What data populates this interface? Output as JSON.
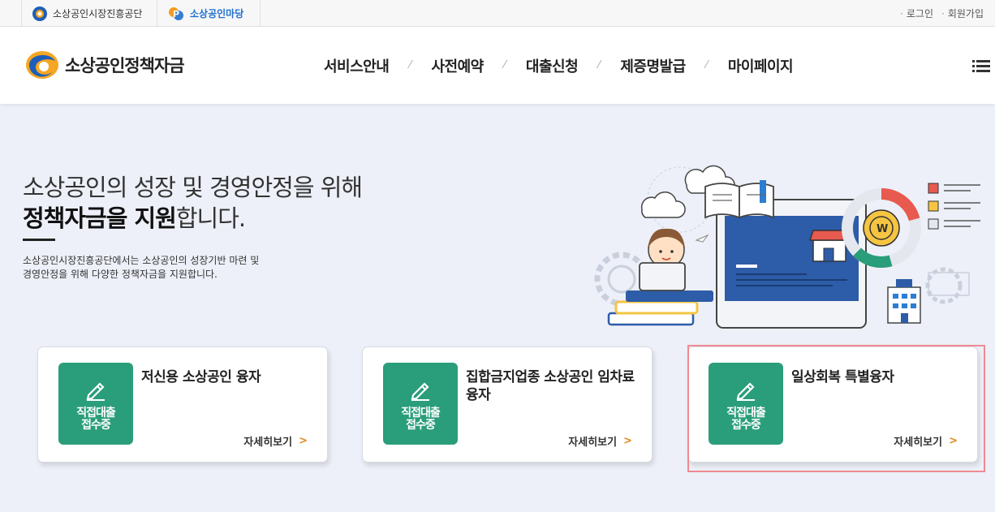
{
  "topbar": {
    "site1": "소상공인시장진흥공단",
    "site2": "소상공인마당",
    "login": "로그인",
    "signup": "회원가입"
  },
  "header": {
    "brand": "소상공인정책자금",
    "menu": [
      "서비스안내",
      "사전예약",
      "대출신청",
      "제증명발급",
      "마이페이지"
    ]
  },
  "hero": {
    "title_line1": "소상공인의 성장 및 경영안정을 위해",
    "title_bold": "정책자금을 지원",
    "title_tail": "합니다.",
    "desc_line1": "소상공인시장진흥공단에서는 소상공인의 성장기반 마련 및",
    "desc_line2": "경영안정을 위해 다양한 정책자금을 지원합니다."
  },
  "cards": [
    {
      "badge_line1": "직접대출",
      "badge_line2": "접수중",
      "title": "저신용 소상공인 융자",
      "more": "자세히보기"
    },
    {
      "badge_line1": "직접대출",
      "badge_line2": "접수중",
      "title": "집합금지업종 소상공인 임차료융자",
      "more": "자세히보기"
    },
    {
      "badge_line1": "직접대출",
      "badge_line2": "접수중",
      "title": "일상회복 특별융자",
      "more": "자세히보기"
    }
  ],
  "colors": {
    "badge": "#2a9d7a",
    "highlight": "#ef8a92",
    "accent_chevron": "#e08a1e"
  }
}
